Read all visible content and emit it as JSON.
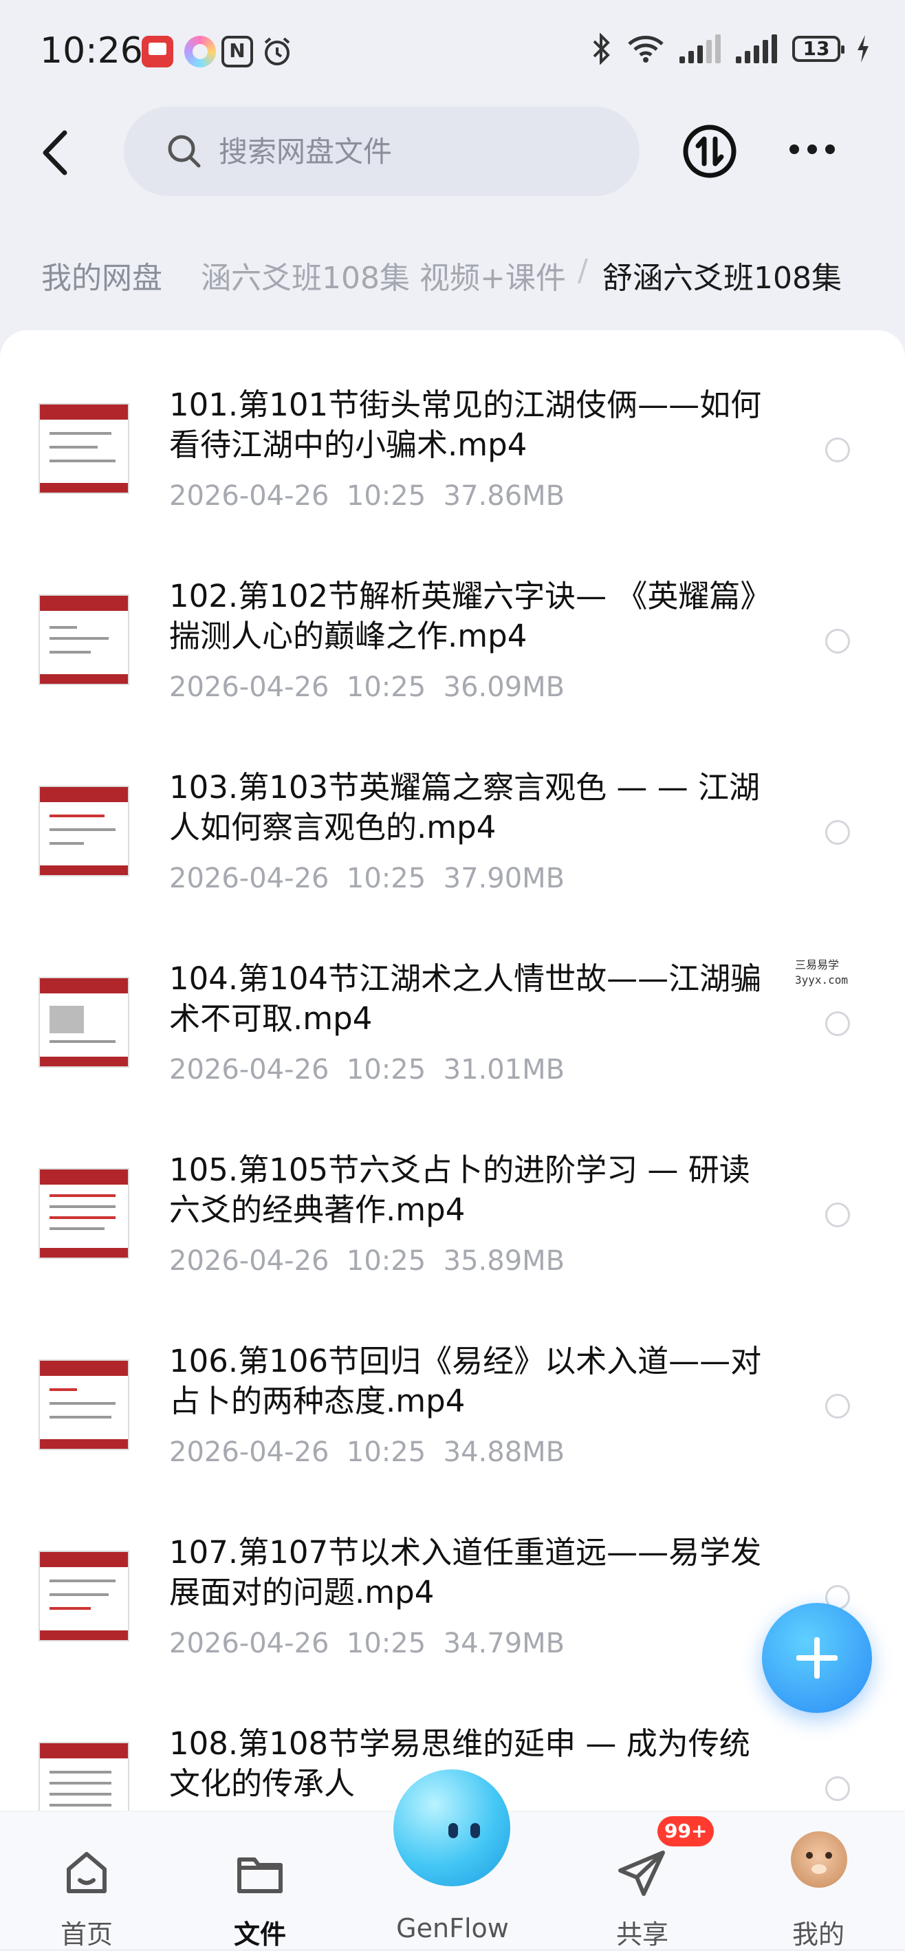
{
  "status_bar": {
    "time": "10:26",
    "battery": "13",
    "icons": [
      "app-red-icon",
      "colorful-ring-icon",
      "nfc-icon",
      "alarm-icon",
      "bluetooth-icon",
      "wifi-icon",
      "signal-icon",
      "signal-icon",
      "battery-icon",
      "charging-icon"
    ]
  },
  "header": {
    "back_icon": "chevron-left-icon",
    "search_placeholder": "搜索网盘文件",
    "transfer_icon": "transfer-icon",
    "more_icon": "more-dots-icon"
  },
  "breadcrumb": {
    "root": "我的网盘",
    "middle": "涵六爻班108集 视频+课件",
    "separator": "/",
    "current": "舒涵六爻班108集"
  },
  "files": [
    {
      "name": "101.第101节街头常见的江湖伎俩——如何看待江湖中的小骗术.mp4",
      "date": "2026-04-26",
      "time": "10:25",
      "size": "37.86MB"
    },
    {
      "name": "102.第102节解析英耀六字诀— 《英耀篇》揣测人心的巅峰之作.mp4",
      "date": "2026-04-26",
      "time": "10:25",
      "size": "36.09MB"
    },
    {
      "name": "103.第103节英耀篇之察言观色 — — 江湖人如何察言观色的.mp4",
      "date": "2026-04-26",
      "time": "10:25",
      "size": "37.90MB"
    },
    {
      "name": "104.第104节江湖术之人情世故——江湖骗术不可取.mp4",
      "date": "2026-04-26",
      "time": "10:25",
      "size": "31.01MB"
    },
    {
      "name": "105.第105节六爻占卜的进阶学习 — 研读六爻的经典著作.mp4",
      "date": "2026-04-26",
      "time": "10:25",
      "size": "35.89MB"
    },
    {
      "name": "106.第106节回归《易经》以术入道——对占卜的两种态度.mp4",
      "date": "2026-04-26",
      "time": "10:25",
      "size": "34.88MB"
    },
    {
      "name": "107.第107节以术入道任重道远——易学发展面对的问题.mp4",
      "date": "2026-04-26",
      "time": "10:25",
      "size": "34.79MB"
    },
    {
      "name": "108.第108节学易思维的延申 — 成为传统文化的传承人",
      "date": "",
      "time": "",
      "size": ""
    }
  ],
  "watermark": {
    "line1": "三易易学",
    "line2": "3yyx.com"
  },
  "fab_icon": "plus-icon",
  "bottom_nav": {
    "items": [
      {
        "label": "首页",
        "icon": "home-icon",
        "active": false
      },
      {
        "label": "文件",
        "icon": "folder-icon",
        "active": true
      },
      {
        "label": "GenFlow",
        "icon": "genflow-orb-icon",
        "active": false
      },
      {
        "label": "共享",
        "icon": "paper-plane-icon",
        "active": false
      },
      {
        "label": "我的",
        "icon": "avatar-icon",
        "active": false
      }
    ],
    "share_badge": "99+"
  },
  "colors": {
    "accent": "#2a8cf5",
    "badge": "#ff3b30",
    "thumb_red": "#b0262a"
  }
}
